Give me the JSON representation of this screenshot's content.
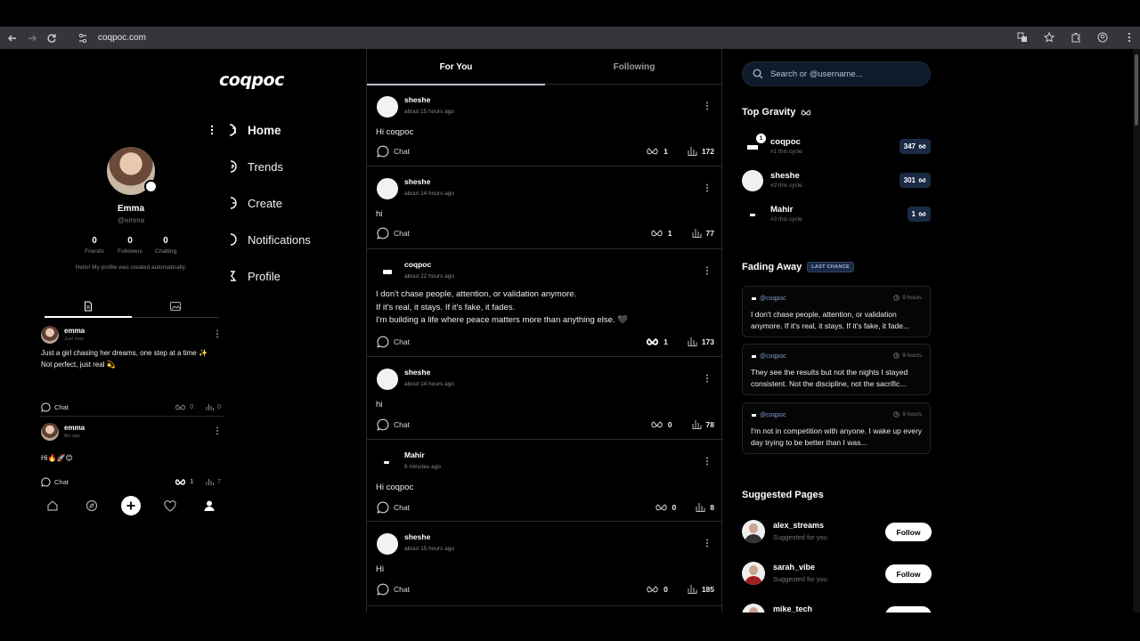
{
  "browser": {
    "url": "coqpoc.com"
  },
  "app": {
    "logo": "coqpoc"
  },
  "nav": {
    "items": [
      {
        "label": "Home",
        "icon": "home-icon",
        "active": true
      },
      {
        "label": "Trends",
        "icon": "trends-icon"
      },
      {
        "label": "Create",
        "icon": "create-icon"
      },
      {
        "label": "Notifications",
        "icon": "notifications-icon"
      },
      {
        "label": "Profile",
        "icon": "profile-icon"
      }
    ]
  },
  "profile": {
    "name": "Emma",
    "handle": "@emma",
    "stats": [
      {
        "value": "0",
        "label": "Friends"
      },
      {
        "value": "0",
        "label": "Followers"
      },
      {
        "value": "0",
        "label": "Chatting"
      }
    ],
    "bio": "Hello! My profile was created automatically."
  },
  "profile_posts": [
    {
      "name": "emma",
      "time": "Just now",
      "text": "Just a girl chasing her dreams, one step at a time ✨\nNot perfect, just real 💫",
      "chat": "Chat",
      "gravity": "0",
      "views": "0"
    },
    {
      "name": "emma",
      "time": "8m ago",
      "text": "Hi🔥🚀😊",
      "chat": "Chat",
      "gravity": "1",
      "views": "7"
    }
  ],
  "feed": {
    "tabs": [
      {
        "label": "For You",
        "active": true
      },
      {
        "label": "Following",
        "active": false
      }
    ],
    "posts": [
      {
        "name": "sheshe",
        "time": "about 15 hours ago",
        "text": "Hi coqpoc",
        "chat": "Chat",
        "gravity": "1",
        "views": "172",
        "avatar": "white"
      },
      {
        "name": "sheshe",
        "time": "about 14 hours ago",
        "text": "hi",
        "chat": "Chat",
        "gravity": "1",
        "views": "77",
        "avatar": "white"
      },
      {
        "name": "coqpoc",
        "time": "about 22 hours ago",
        "text": "I don't chase people, attention, or validation anymore.\nIf it's real, it stays. If it's fake, it fades.\nI'm building a life where peace matters more than anything else. 🖤",
        "chat": "Chat",
        "gravity": "1",
        "views": "173",
        "avatar": "dark"
      },
      {
        "name": "sheshe",
        "time": "about 14 hours ago",
        "text": "hi",
        "chat": "Chat",
        "gravity": "0",
        "views": "78",
        "avatar": "white"
      },
      {
        "name": "Mahir",
        "time": "6 minutes ago",
        "text": "Hi coqpoc",
        "chat": "Chat",
        "gravity": "0",
        "views": "8",
        "avatar": "dark-small"
      },
      {
        "name": "sheshe",
        "time": "about 15 hours ago",
        "text": "Hi",
        "chat": "Chat",
        "gravity": "0",
        "views": "185",
        "avatar": "white"
      }
    ]
  },
  "search": {
    "placeholder": "Search or @username..."
  },
  "top_gravity": {
    "title": "Top Gravity",
    "items": [
      {
        "name": "coqpoc",
        "rank": "#1 this cycle",
        "score": "347",
        "notif": "1"
      },
      {
        "name": "sheshe",
        "rank": "#2 this cycle",
        "score": "301"
      },
      {
        "name": "Mahir",
        "rank": "#3 this cycle",
        "score": "1"
      }
    ]
  },
  "fading_away": {
    "title": "Fading Away",
    "badge": "LAST CHANCE",
    "items": [
      {
        "user": "@coqpoc",
        "time": "9 hours",
        "text": "I don't chase people, attention, or validation anymore. If it's real, it stays. If it's fake, it fade..."
      },
      {
        "user": "@coqpoc",
        "time": "9 hours",
        "text": "They see the results but not the nights I stayed consistent. Not the discipline, not the sacrific..."
      },
      {
        "user": "@coqpoc",
        "time": "9 hours",
        "text": "I'm not in competition with anyone. I wake up every day trying to be better than I was..."
      }
    ]
  },
  "suggested": {
    "title": "Suggested Pages",
    "items": [
      {
        "name": "alex_streams",
        "sub": "Suggested for you",
        "button": "Follow"
      },
      {
        "name": "sarah_vibe",
        "sub": "Suggested for you",
        "button": "Follow"
      },
      {
        "name": "mike_tech",
        "sub": "",
        "button": ""
      }
    ]
  }
}
